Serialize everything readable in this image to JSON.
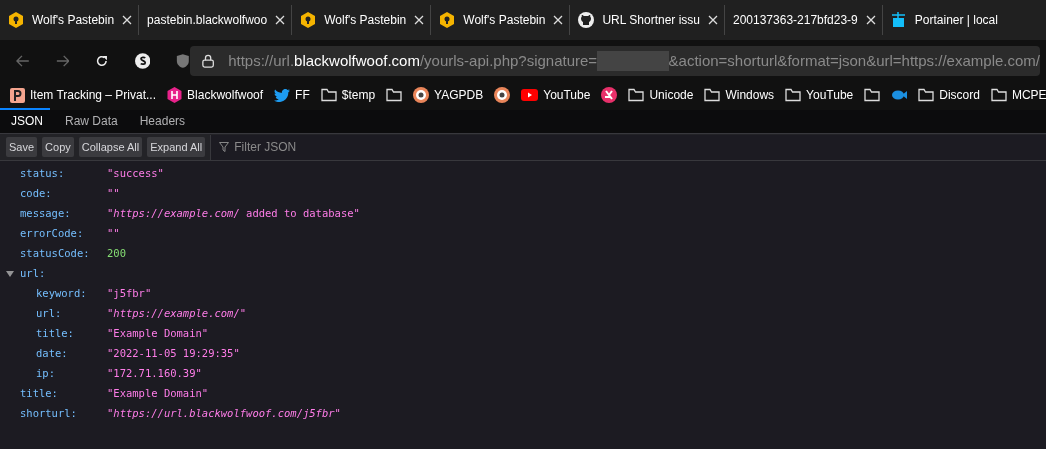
{
  "tabs": [
    {
      "title": "Wolf's Pastebin"
    },
    {
      "title": "pastebin.blackwolfwoo"
    },
    {
      "title": "Wolf's Pastebin"
    },
    {
      "title": "Wolf's Pastebin"
    },
    {
      "title": "URL Shortner issu"
    },
    {
      "title": "200137363-217bfd23-9"
    },
    {
      "title": "Portainer | local"
    }
  ],
  "address_bar": {
    "scheme": "https://url.",
    "domain": "blackwolfwoof.com",
    "path": "/yourls-api.php?signature=",
    "query": "&action=shorturl&format=json&url=https://example.com/"
  },
  "bookmarks": [
    {
      "kind": "link",
      "label": "Item Tracking – Privat..."
    },
    {
      "kind": "link",
      "label": "Blackwolfwoof"
    },
    {
      "kind": "link",
      "label": "FF"
    },
    {
      "kind": "link",
      "label": "$temp"
    },
    {
      "kind": "icon"
    },
    {
      "kind": "link",
      "label": "YAGPDB"
    },
    {
      "kind": "icon"
    },
    {
      "kind": "link",
      "label": "YouTube"
    },
    {
      "kind": "icon"
    },
    {
      "kind": "link",
      "label": "Unicode"
    },
    {
      "kind": "link",
      "label": "Windows"
    },
    {
      "kind": "link",
      "label": "YouTube"
    },
    {
      "kind": "icon"
    },
    {
      "kind": "icon"
    },
    {
      "kind": "link",
      "label": "Discord"
    },
    {
      "kind": "link",
      "label": "MCPE"
    }
  ],
  "viewer_tabs": [
    {
      "label": "JSON",
      "selected": true
    },
    {
      "label": "Raw Data",
      "selected": false
    },
    {
      "label": "Headers",
      "selected": false
    }
  ],
  "toolbar_buttons": [
    "Save",
    "Copy",
    "Collapse All",
    "Expand All"
  ],
  "filter": {
    "placeholder": "Filter JSON"
  },
  "json_rows": [
    {
      "key": "status:",
      "value": "\"success\"",
      "kind": "string"
    },
    {
      "key": "code:",
      "value": "\"\"",
      "kind": "string"
    },
    {
      "key": "message:",
      "value": "\"*https://example.com/* added to database\"",
      "kind": "string"
    },
    {
      "key": "errorCode:",
      "value": "\"\"",
      "kind": "string"
    },
    {
      "key": "statusCode:",
      "value": "200",
      "kind": "number"
    },
    {
      "key": "url:",
      "kind": "object",
      "expanded": true,
      "children": [
        {
          "key": "keyword:",
          "value": "\"j5fbr\"",
          "kind": "string"
        },
        {
          "key": "url:",
          "value": "\"*https://example.com/*\"",
          "kind": "string"
        },
        {
          "key": "title:",
          "value": "\"Example Domain\"",
          "kind": "string"
        },
        {
          "key": "date:",
          "value": "\"2022-11-05 19:29:35\"",
          "kind": "string"
        },
        {
          "key": "ip:",
          "value": "\"172.71.160.39\"",
          "kind": "string"
        }
      ]
    },
    {
      "key": "title:",
      "value": "\"Example Domain\"",
      "kind": "string"
    },
    {
      "key": "shorturl:",
      "value": "\"*https://url.blackwolfwoof.com/j5fbr*\"",
      "kind": "string"
    }
  ]
}
